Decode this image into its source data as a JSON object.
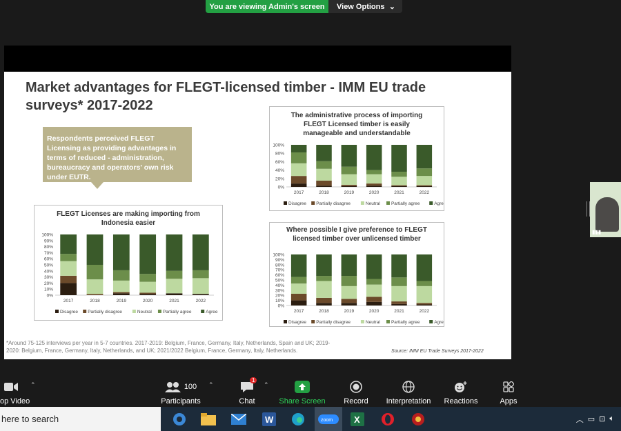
{
  "banner": {
    "viewing_text": "You are viewing Admin's screen",
    "options_label": "View Options"
  },
  "slide": {
    "title_line1": "Market advantages for FLEGT-licensed timber - IMM EU trade",
    "title_line2": "surveys* 2017-2022",
    "callout": "Respondents perceived FLEGT Licensing as providing advantages in terms of reduced - administration, bureaucracy and operators' own risk under EUTR.",
    "footnote_line1": "*Around 75-125 interviews per year in 5-7 countries. 2017-2019: Belgium, France, Germany, Italy, Netherlands, Spain and UK; 2019-",
    "footnote_line2": "2020: Belgium, France, Germany, Italy, Netherlands, and UK; 2021/2022 Belgium, France, Germany, Italy, Netherlands.",
    "source": "Source: IMM EU Trade Surveys 2017-2022"
  },
  "chart_data": [
    {
      "type": "bar",
      "stacked": true,
      "title": "FLEGT Licenses are making importing from Indonesia easier",
      "categories": [
        "2017",
        "2018",
        "2019",
        "2020",
        "2021",
        "2022"
      ],
      "y_ticks": [
        "0%",
        "10%",
        "20%",
        "30%",
        "40%",
        "50%",
        "60%",
        "70%",
        "80%",
        "90%",
        "100%"
      ],
      "ylim": [
        0,
        100
      ],
      "series": [
        {
          "name": "Disagree",
          "color": "#2b1d10",
          "values": [
            20,
            0,
            3,
            2,
            3,
            2
          ]
        },
        {
          "name": "Partially disagree",
          "color": "#6b4a2a",
          "values": [
            12,
            2,
            2,
            2,
            0,
            0
          ]
        },
        {
          "name": "Neutral",
          "color": "#bdd9a0",
          "values": [
            24,
            24,
            19,
            18,
            24,
            26
          ]
        },
        {
          "name": "Partially agree",
          "color": "#6c8e4a",
          "values": [
            12,
            24,
            17,
            13,
            13,
            13
          ]
        },
        {
          "name": "Agree",
          "color": "#3a5a2a",
          "values": [
            32,
            50,
            59,
            65,
            60,
            59
          ]
        }
      ],
      "legend_position": "bottom"
    },
    {
      "type": "bar",
      "stacked": true,
      "title": "The administrative process of importing FLEGT Licensed timber is easily manageable and understandable",
      "categories": [
        "2017",
        "2018",
        "2019",
        "2020",
        "2021",
        "2022"
      ],
      "y_ticks": [
        "0%",
        "20%",
        "40%",
        "60%",
        "80%",
        "100%"
      ],
      "ylim": [
        0,
        100
      ],
      "series": [
        {
          "name": "Disagree",
          "color": "#2b1d10",
          "values": [
            8,
            3,
            2,
            3,
            2,
            2
          ]
        },
        {
          "name": "Partially disagree",
          "color": "#6b4a2a",
          "values": [
            18,
            12,
            3,
            5,
            2,
            2
          ]
        },
        {
          "name": "Neutral",
          "color": "#bdd9a0",
          "values": [
            30,
            28,
            25,
            22,
            20,
            22
          ]
        },
        {
          "name": "Partially agree",
          "color": "#6c8e4a",
          "values": [
            26,
            18,
            18,
            10,
            12,
            18
          ]
        },
        {
          "name": "Agree",
          "color": "#3a5a2a",
          "values": [
            18,
            39,
            52,
            60,
            64,
            56
          ]
        }
      ],
      "legend_position": "bottom"
    },
    {
      "type": "bar",
      "stacked": true,
      "title": "Where possible I give preference to FLEGT licensed timber over unlicensed timber",
      "categories": [
        "2017",
        "2018",
        "2019",
        "2020",
        "2021",
        "2022"
      ],
      "y_ticks": [
        "0%",
        "10%",
        "20%",
        "30%",
        "40%",
        "50%",
        "60%",
        "70%",
        "80%",
        "90%",
        "100%"
      ],
      "ylim": [
        0,
        100
      ],
      "series": [
        {
          "name": "Disagree",
          "color": "#2b1d10",
          "values": [
            10,
            5,
            5,
            7,
            3,
            2
          ]
        },
        {
          "name": "Partially disagree",
          "color": "#6b4a2a",
          "values": [
            13,
            10,
            8,
            10,
            5,
            3
          ]
        },
        {
          "name": "Neutral",
          "color": "#bdd9a0",
          "values": [
            20,
            33,
            25,
            24,
            30,
            33
          ]
        },
        {
          "name": "Partially agree",
          "color": "#6c8e4a",
          "values": [
            13,
            10,
            20,
            11,
            17,
            10
          ]
        },
        {
          "name": "Agree",
          "color": "#3a5a2a",
          "values": [
            44,
            42,
            42,
            48,
            45,
            52
          ]
        }
      ],
      "legend_position": "bottom"
    }
  ],
  "toolbar": {
    "video_label": "op Video",
    "participants_label": "Participants",
    "participants_count": "100",
    "chat_label": "Chat",
    "chat_badge": "1",
    "share_label": "Share Screen",
    "record_label": "Record",
    "interpretation_label": "Interpretation",
    "reactions_label": "Reactions",
    "apps_label": "Apps"
  },
  "taskbar": {
    "search_placeholder": "here to search"
  },
  "colors": {
    "zoom_green": "#23a043",
    "agree": "#3a5a2a",
    "neutral": "#bdd9a0"
  }
}
